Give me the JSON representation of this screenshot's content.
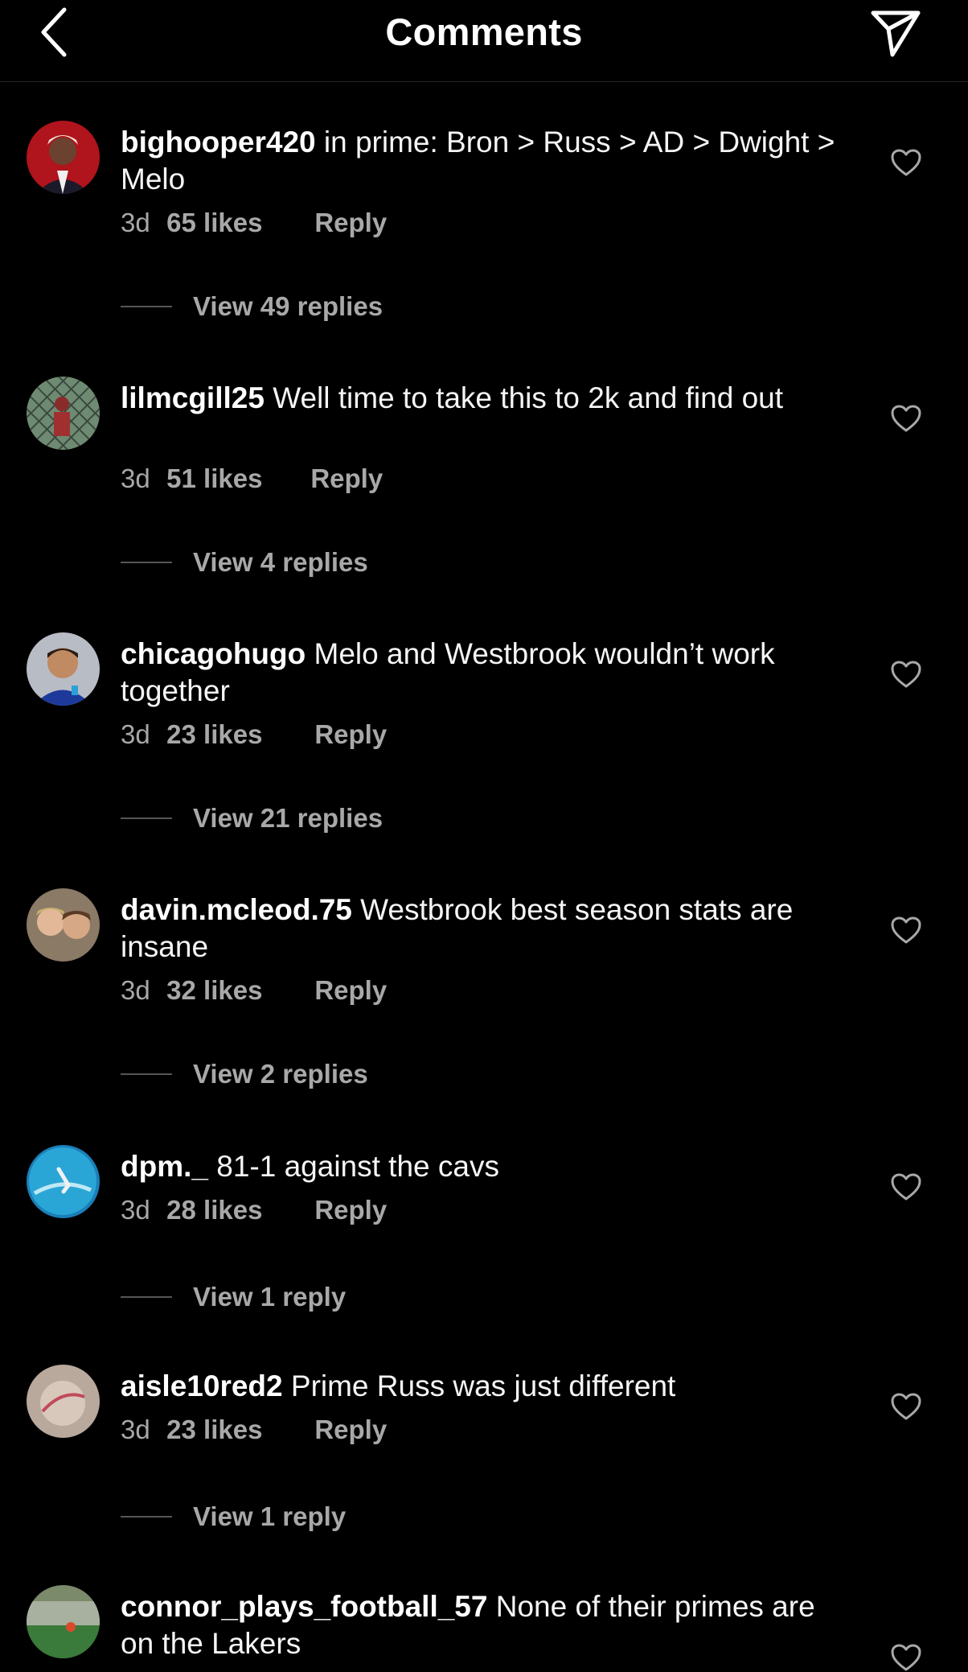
{
  "header": {
    "title": "Comments",
    "back_icon": "chevron-left-icon",
    "send_icon": "paper-plane-icon"
  },
  "colors": {
    "background": "#000000",
    "text": "#f5f5f5",
    "secondary": "#a8a8a8"
  },
  "comments": [
    {
      "username": "bighooper420",
      "text": "in prime: Bron > Russ > AD > Dwight > Melo",
      "time": "3d",
      "likes": "65 likes",
      "reply": "Reply",
      "view_replies": "View 49 replies"
    },
    {
      "username": "lilmcgill25",
      "text": "Well time to take this to 2k and find out",
      "time": "3d",
      "likes": "51 likes",
      "reply": "Reply",
      "view_replies": "View 4 replies"
    },
    {
      "username": "chicagohugo",
      "text": "Melo and Westbrook wouldn’t work together",
      "time": "3d",
      "likes": "23 likes",
      "reply": "Reply",
      "view_replies": "View 21 replies"
    },
    {
      "username": "davin.mcleod.75",
      "text": "Westbrook best season stats are insane",
      "time": "3d",
      "likes": "32 likes",
      "reply": "Reply",
      "view_replies": "View 2 replies"
    },
    {
      "username": "dpm._",
      "text": "81-1 against the cavs",
      "time": "3d",
      "likes": "28 likes",
      "reply": "Reply",
      "view_replies": "View 1 reply"
    },
    {
      "username": "aisle10red2",
      "text": "Prime Russ was just different",
      "time": "3d",
      "likes": "23 likes",
      "reply": "Reply",
      "view_replies": "View 1 reply"
    },
    {
      "username": "connor_plays_football_57",
      "text": "None of their primes are on the Lakers"
    }
  ]
}
